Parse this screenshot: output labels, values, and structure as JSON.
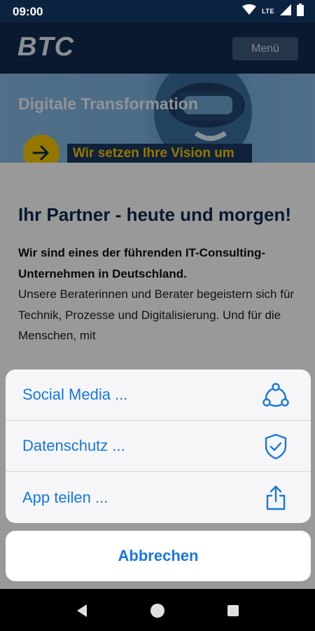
{
  "status_bar": {
    "time": "09:00",
    "network": "LTE"
  },
  "header": {
    "logo": "BTC",
    "menu_label": "Menü"
  },
  "hero": {
    "title": "Digitale Transformation",
    "cta": "Wir setzen Ihre Vision um"
  },
  "content": {
    "heading": "Ihr Partner - heute und morgen!",
    "intro_bold": "Wir sind eines der führenden IT-Consulting-Unternehmen in Deutschland.",
    "intro_text": "Unsere Beraterinnen und Berater begeistern sich für Technik, Prozesse und Digitalisierung. Und für die Menschen, mit"
  },
  "action_sheet": {
    "items": [
      {
        "label": "Social Media ...",
        "icon": "share-network-icon"
      },
      {
        "label": "Datenschutz ...",
        "icon": "shield-check-icon"
      },
      {
        "label": "App teilen ...",
        "icon": "share-upload-icon"
      }
    ],
    "cancel_label": "Abbrechen"
  },
  "colors": {
    "accent": "#1877e0",
    "brand_dark": "#0e2b50",
    "highlight": "#f7c600"
  }
}
